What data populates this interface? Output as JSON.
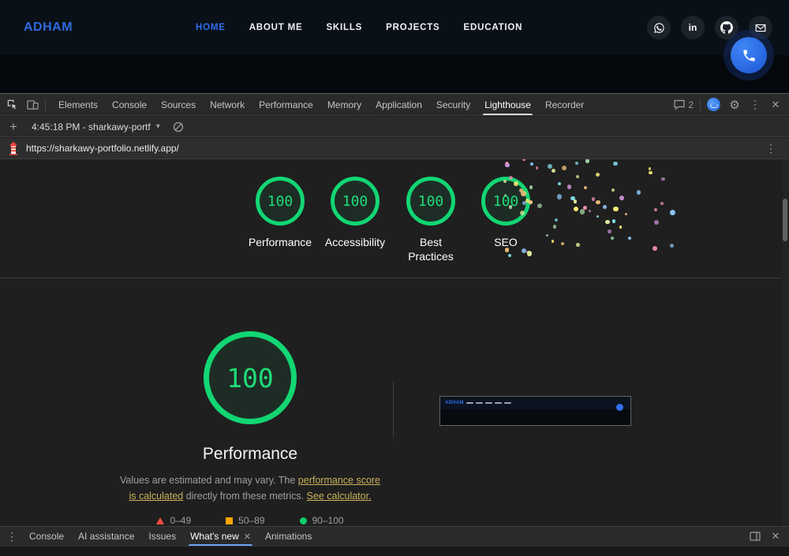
{
  "site": {
    "logo": "ADHAM",
    "nav": [
      {
        "label": "HOME"
      },
      {
        "label": "ABOUT ME"
      },
      {
        "label": "SKILLS"
      },
      {
        "label": "PROJECTS"
      },
      {
        "label": "EDUCATION"
      }
    ],
    "active_nav": "HOME",
    "social_icons": [
      "whatsapp",
      "linkedin",
      "github",
      "email"
    ]
  },
  "devtools": {
    "tabs": [
      "Elements",
      "Console",
      "Sources",
      "Network",
      "Performance",
      "Memory",
      "Application",
      "Security",
      "Lighthouse",
      "Recorder"
    ],
    "active_tab": "Lighthouse",
    "messages_count": "2",
    "session_label": "4:45:18 PM - sharkawy-portf",
    "url": "https://sharkawy-portfolio.netlify.app/",
    "drawer_tabs": [
      "Console",
      "AI assistance",
      "Issues",
      "What's new",
      "Animations"
    ],
    "drawer_active": "What's new"
  },
  "lighthouse": {
    "scores": [
      {
        "value": "100",
        "label": "Performance"
      },
      {
        "value": "100",
        "label": "Accessibility"
      },
      {
        "value": "100",
        "label": "Best Practices"
      },
      {
        "value": "100",
        "label": "SEO"
      }
    ],
    "metric_detail": {
      "value": "100",
      "title": "Performance",
      "desc_before": "Values are estimated and may vary. The ",
      "link_calc": "performance score is calculated",
      "desc_middle": " directly from these metrics. ",
      "link_see": "See calculator.",
      "legend": [
        {
          "range": "0–49",
          "color": "#ff4e42",
          "shape": "triangle"
        },
        {
          "range": "50–89",
          "color": "#ffa400",
          "shape": "square"
        },
        {
          "range": "90–100",
          "color": "#0cce6b",
          "shape": "circle"
        }
      ]
    },
    "colors": {
      "pass": "#12d673",
      "average": "#ffa400",
      "fail": "#ff4e42"
    },
    "thumbnail_logo": "ADHAM"
  }
}
